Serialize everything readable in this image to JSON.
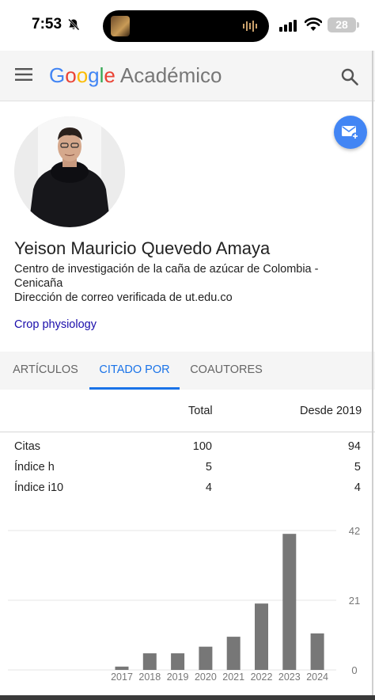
{
  "status_bar": {
    "time": "7:53",
    "battery": "28"
  },
  "header": {
    "logo": {
      "g": "G",
      "o1": "o",
      "o2": "o",
      "g2": "g",
      "l": "l",
      "e": "e",
      "product": "Académico"
    }
  },
  "profile": {
    "name": "Yeison Mauricio Quevedo Amaya",
    "affiliation": "Centro de investigación de la caña de azúcar de Colombia - Cenicaña",
    "email_verified": "Dirección de correo verificada de ut.edu.co",
    "interests": [
      "Crop physiology"
    ]
  },
  "tabs": [
    {
      "label": "ARTÍCULOS",
      "active": false
    },
    {
      "label": "CITADO POR",
      "active": true
    },
    {
      "label": "COAUTORES",
      "active": false
    }
  ],
  "citation_table": {
    "headers": {
      "total": "Total",
      "since": "Desde 2019"
    },
    "rows": [
      {
        "label": "Citas",
        "total": "100",
        "since": "94"
      },
      {
        "label": "Índice h",
        "total": "5",
        "since": "5"
      },
      {
        "label": "Índice i10",
        "total": "4",
        "since": "4"
      }
    ]
  },
  "colors": {
    "accent": "#1a73e8",
    "bar": "#777777",
    "follow_button": "#4285f4",
    "link": "#1a0dab"
  },
  "chart_data": {
    "type": "bar",
    "categories": [
      "2017",
      "2018",
      "2019",
      "2020",
      "2021",
      "2022",
      "2023",
      "2024"
    ],
    "values": [
      1,
      5,
      5,
      7,
      10,
      20,
      41,
      11
    ],
    "yticks": [
      "0",
      "21",
      "42"
    ],
    "ylim": [
      0,
      42
    ],
    "grid": true,
    "title": "",
    "xlabel": "",
    "ylabel": ""
  }
}
